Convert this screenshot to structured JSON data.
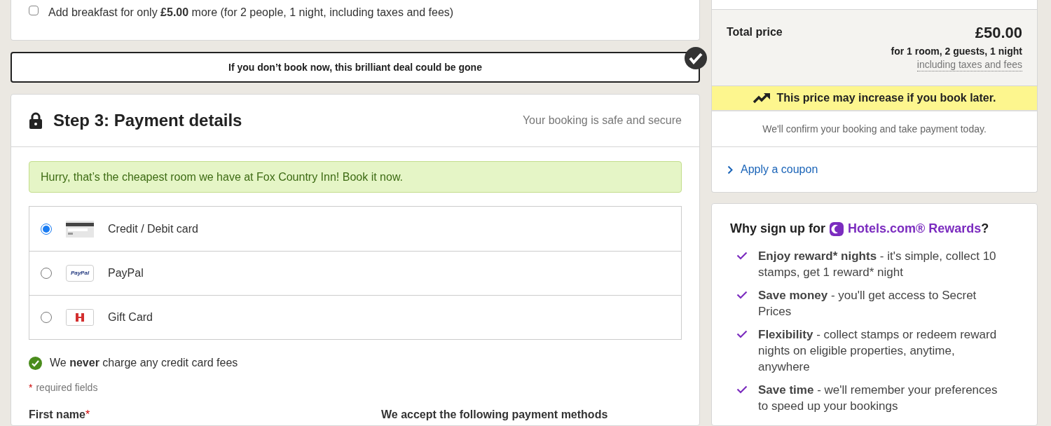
{
  "breakfast": {
    "checked": false,
    "text": "Add breakfast for only **£5.00** more (for 2 people, 1 night, including taxes and fees)"
  },
  "urgency_banner": {
    "text": "If you don’t book now, this brilliant deal could be gone"
  },
  "payment": {
    "title": "Step 3: Payment details",
    "secure_note": "Your booking is safe and secure",
    "alert": "Hurry, that’s the cheapest room we have at Fox Country Inn! Book it now.",
    "methods": [
      {
        "kind": "card",
        "label": "Credit / Debit card",
        "selected": true
      },
      {
        "kind": "paypal",
        "label": "PayPal",
        "logo_text": "PayPal",
        "selected": false
      },
      {
        "kind": "gift",
        "label": "Gift Card",
        "selected": false
      }
    ],
    "fees_note": "We **never** charge any credit card fees",
    "required_mark": "*",
    "required_note": "required fields",
    "first_name_label": "First name",
    "first_name_mark": "*",
    "accepted_heading": "We accept the following payment methods"
  },
  "summary": {
    "total_label": "Total price",
    "total_amount": "£50.00",
    "total_detail": "for 1 room, 2 guests, 1 night",
    "taxes_link": "including taxes and fees",
    "price_warning": "This price may increase if you book later.",
    "confirm_note": "We'll confirm your booking and take payment today.",
    "coupon_link": "Apply a coupon"
  },
  "rewards": {
    "heading_prefix": "Why sign up for",
    "brand": "Hotels.com® Rewards",
    "heading_suffix": "?",
    "benefits": [
      {
        "title": "Enjoy reward* nights",
        "text": "- it's simple, collect 10 stamps, get 1 reward* night"
      },
      {
        "title": "Save money",
        "text": "- you'll get access to Secret Prices"
      },
      {
        "title": "Flexibility",
        "text": "- collect stamps or redeem reward nights on eligible properties, anytime, anywhere"
      },
      {
        "title": "Save time",
        "text": "- we'll remember your preferences to speed up your bookings"
      }
    ]
  }
}
